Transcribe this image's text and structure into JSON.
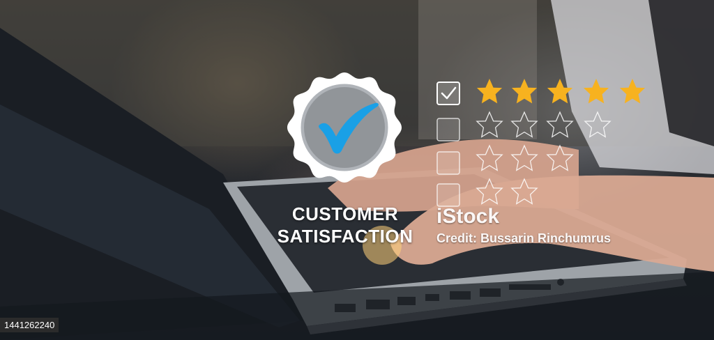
{
  "image": {
    "title_line1": "CUSTOMER",
    "title_line2": "SATISFACTION",
    "watermark_logo": "iStock",
    "watermark_credit": "Credit: Bussarin Rinchumrus",
    "stock_id": "1441262240"
  },
  "rating": {
    "rows": [
      {
        "checked": true,
        "stars": 5,
        "filled": true
      },
      {
        "checked": false,
        "stars": 4,
        "filled": false
      },
      {
        "checked": false,
        "stars": 3,
        "filled": false
      },
      {
        "checked": false,
        "stars": 2,
        "filled": false
      }
    ]
  },
  "colors": {
    "accent_blue": "#1aa0e6",
    "star_gold": "#f7b21f",
    "outline_white": "#ffffff"
  }
}
